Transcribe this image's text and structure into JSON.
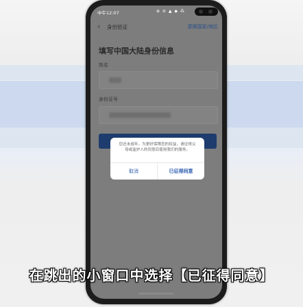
{
  "status": {
    "time": "中午12:07",
    "icons": "⊕ ⊘ ▲ ◆ ⁂",
    "battery": "92"
  },
  "appbar": {
    "title": "身份验证",
    "region_link": "更换国家/地区"
  },
  "form": {
    "heading": "填写中国大陆身份信息",
    "name_label": "姓名",
    "id_label": "身份证号"
  },
  "dialog": {
    "message": "您还未成年，为更好保障您的权益，请征得父母或监护人的同意后使用我们的服务。",
    "cancel_label": "取消",
    "agree_label": "已征得同意"
  },
  "caption": "在跳出的小窗口中选择【已征得同意】"
}
